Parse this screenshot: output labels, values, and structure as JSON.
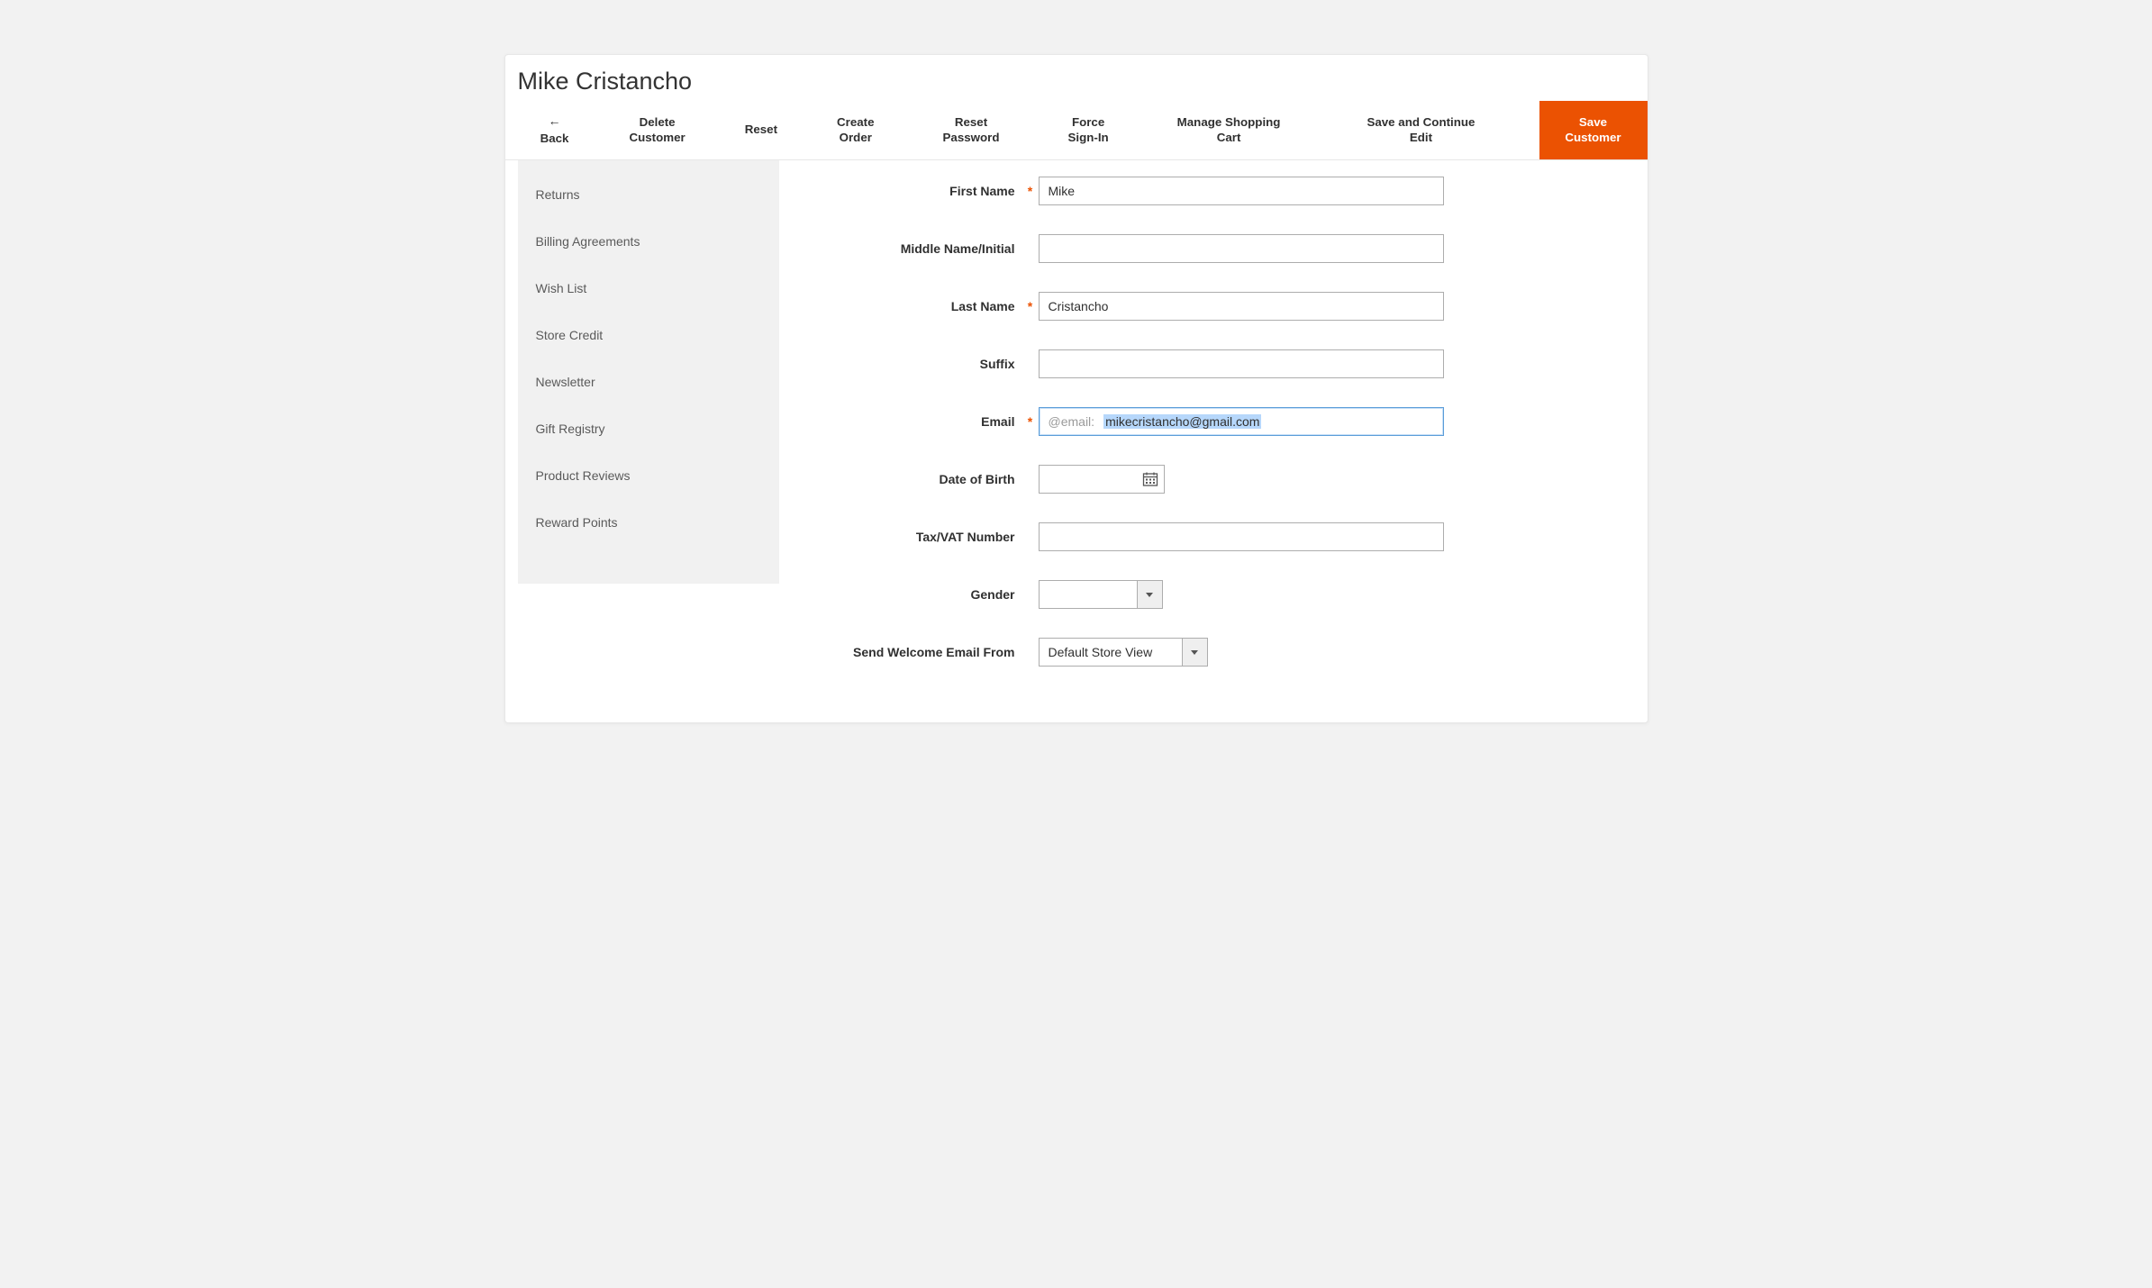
{
  "page_title": "Mike Cristancho",
  "toolbar": {
    "back": "Back",
    "delete": "Delete\nCustomer",
    "reset": "Reset",
    "create_order": "Create\nOrder",
    "reset_password": "Reset\nPassword",
    "force_signin": "Force\nSign-In",
    "manage_cart": "Manage Shopping\nCart",
    "save_continue": "Save and Continue\nEdit",
    "save_customer": "Save\nCustomer"
  },
  "sidebar": {
    "items": [
      {
        "label": "Returns"
      },
      {
        "label": "Billing Agreements"
      },
      {
        "label": "Wish List"
      },
      {
        "label": "Store Credit"
      },
      {
        "label": "Newsletter"
      },
      {
        "label": "Gift Registry"
      },
      {
        "label": "Product Reviews"
      },
      {
        "label": "Reward Points"
      }
    ]
  },
  "form": {
    "first_name": {
      "label": "First Name",
      "required": true,
      "value": "Mike"
    },
    "middle_name": {
      "label": "Middle Name/Initial",
      "required": false,
      "value": ""
    },
    "last_name": {
      "label": "Last Name",
      "required": true,
      "value": "Cristancho"
    },
    "suffix": {
      "label": "Suffix",
      "required": false,
      "value": ""
    },
    "email": {
      "label": "Email",
      "required": true,
      "prefix": "@email:",
      "value": "mikecristancho@gmail.com"
    },
    "dob": {
      "label": "Date of Birth",
      "required": false,
      "value": ""
    },
    "tax_vat": {
      "label": "Tax/VAT Number",
      "required": false,
      "value": ""
    },
    "gender": {
      "label": "Gender",
      "required": false,
      "value": ""
    },
    "welcome_store": {
      "label": "Send Welcome Email From",
      "required": false,
      "value": "Default Store View"
    }
  },
  "required_mark": "*",
  "colors": {
    "accent": "#eb5202"
  }
}
